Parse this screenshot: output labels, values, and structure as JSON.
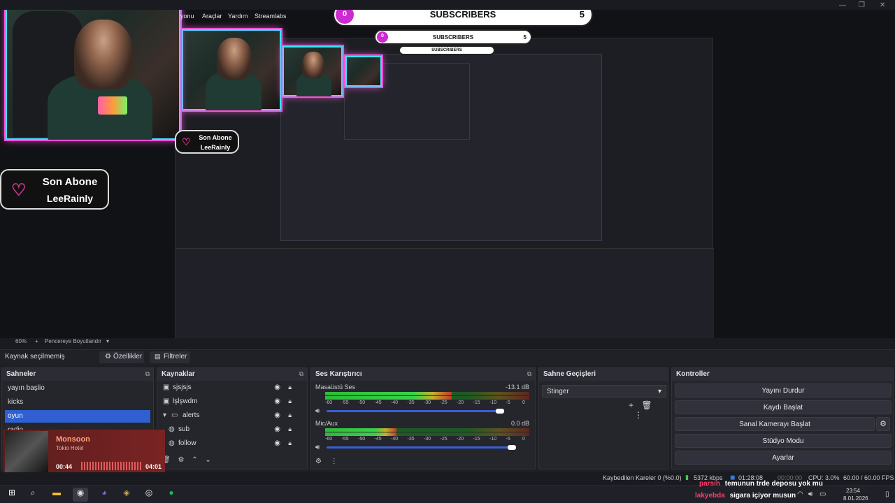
{
  "menu": {
    "items": [
      "yonu",
      "Araçlar",
      "Yardım",
      "Streamlabs"
    ]
  },
  "overlay": {
    "subscribers_label": "SUBSCRIBERS",
    "sub_count_left": "0",
    "sub_count_right": "5",
    "son_abone_title": "Son Abone",
    "son_abone_name": "LeeRainly"
  },
  "preview_toolbar": {
    "zoom": "60%",
    "plus": "+",
    "fit": "Pencereye Boyutlandır",
    "chevron": "▾"
  },
  "source_bar": {
    "no_source": "Kaynak seçilmemiş",
    "properties": "Özellikler",
    "filters": "Filtreler"
  },
  "scenes": {
    "title": "Sahneler",
    "items": [
      "yayın başlio",
      "kicks",
      "oyun",
      "radio"
    ],
    "selected_index": 2
  },
  "sources": {
    "title": "Kaynaklar",
    "items": [
      {
        "label": "sjsjsjs",
        "icon": "image-icon"
      },
      {
        "label": "lşlşwdm",
        "icon": "image-icon"
      },
      {
        "label": "alerts",
        "icon": "folder-icon"
      },
      {
        "label": "sub",
        "icon": "globe-icon"
      },
      {
        "label": "follow",
        "icon": "globe-icon"
      }
    ]
  },
  "mixer": {
    "title": "Ses Karıştırıcı",
    "channels": [
      {
        "name": "Masaüstü Ses",
        "db": "-13.1 dB",
        "level": 0.62,
        "volume": 0.9
      },
      {
        "name": "Mic/Aux",
        "db": "0.0 dB",
        "level": 0.35,
        "volume": 0.96
      }
    ],
    "scale": [
      "-60",
      "-55",
      "-50",
      "-45",
      "-40",
      "-35",
      "-30",
      "-25",
      "-20",
      "-15",
      "-10",
      "-5",
      "0"
    ]
  },
  "transitions": {
    "title": "Sahne Geçişleri",
    "selected": "Stinger"
  },
  "controls": {
    "title": "Kontroller",
    "buttons": [
      "Yayını Durdur",
      "Kaydı Başlat",
      "Sanal Kamerayı Başlat",
      "Stüdyo Modu",
      "Ayarlar"
    ]
  },
  "music": {
    "title": "Monsoon",
    "artist": "Tokio Hotel",
    "elapsed": "00:44",
    "total": "04:01",
    "progress": 0.18
  },
  "status": {
    "dropped": "Kaybedilen Kareler 0 (%0.0)",
    "bitrate": "5372 kbps",
    "stream_time": "01:28:08",
    "rec_time": "00:00:00",
    "cpu": "CPU: 3.0%",
    "fps": "60.00 / 60.00 FPS"
  },
  "chat": [
    {
      "user": "parsin",
      "message": "temunun trde deposu yok mu"
    },
    {
      "user": "lakyebda",
      "message": "sigara içiyor musun"
    }
  ],
  "clock": {
    "time": "23:54",
    "date": "8.01.2026"
  },
  "colors": {
    "accent": "#2f5fd0",
    "neon_pink": "#ff4fd8",
    "neon_cyan": "#3fe0ff",
    "sub_purple": "#cc2bd1"
  }
}
